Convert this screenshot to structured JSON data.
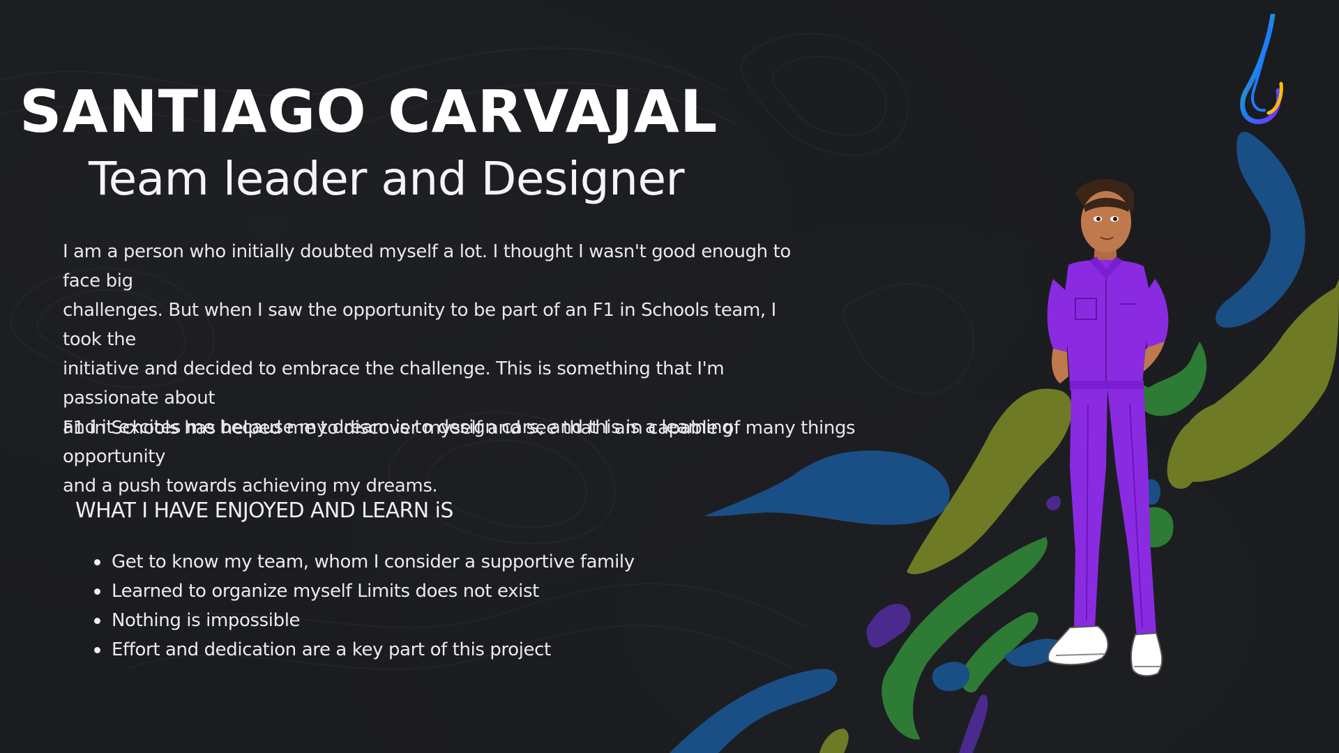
{
  "profile": {
    "name": "SANTIAGO CARVAJAL",
    "role": "Team leader and Designer",
    "bio_lines": [
      "I am a person who initially doubted myself a lot. I thought I wasn't good enough to face big",
      "challenges. But when I saw the opportunity to be part of an F1 in Schools team, I took the",
      "initiative and decided to embrace the challenge. This is something that I'm passionate about",
      "and it excites me because my dream is to design cars, and this is a learning opportunity",
      "and a push towards achieving my dreams."
    ],
    "bio_second": "F1 in Schools has helped me to discover myself and see that I am capable of many things"
  },
  "enjoyed": {
    "heading": "WHAT I HAVE ENJOYED AND LEARN iS",
    "items": [
      "Get to know my team, whom I consider a supportive family",
      "Learned to organize myself Limits does not exist",
      "Nothing is impossible",
      "Effort and dedication are a key part of this project"
    ]
  },
  "colors": {
    "background": "#1b1c20",
    "blue_blob": "#1a4f86",
    "olive_blob": "#6f7a25",
    "green_blob": "#2e7b35",
    "purple_blob": "#4a2a8c",
    "jumpsuit": "#8a2be2",
    "text": "#f2f2f2"
  },
  "icons": {
    "logo": "rainbow-comet-logo",
    "illustration": "character-in-purple-jumpsuit"
  }
}
